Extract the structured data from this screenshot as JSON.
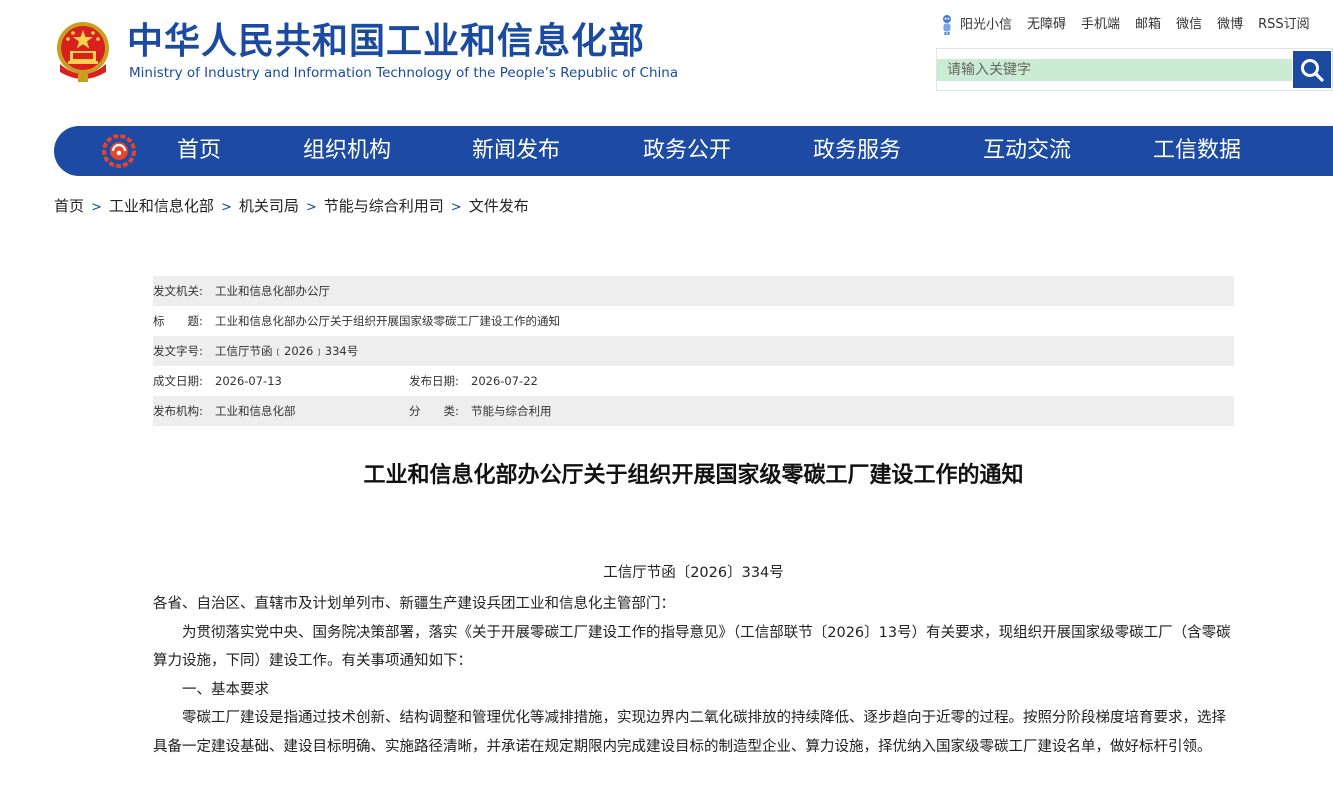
{
  "header": {
    "title_cn": "中华人民共和国工业和信息化部",
    "title_en": "Ministry of Industry and Information Technology of the People’s Republic of China",
    "top_links": [
      "阳光小信",
      "无障碍",
      "手机端",
      "邮箱",
      "微信",
      "微博",
      "RSS订阅"
    ],
    "search_placeholder": "请输入关键字"
  },
  "nav": {
    "items": [
      "首页",
      "组织机构",
      "新闻发布",
      "政务公开",
      "政务服务",
      "互动交流",
      "工信数据"
    ]
  },
  "breadcrumb": [
    "首页",
    "工业和信息化部",
    "机关司局",
    "节能与综合利用司",
    "文件发布"
  ],
  "meta": {
    "issuer_label": "发文机关:",
    "issuer": "工业和信息化部办公厅",
    "title_label": "标　　题:",
    "title": "工业和信息化部办公厅关于组织开展国家级零碳工厂建设工作的通知",
    "doc_no_label": "发文字号:",
    "doc_no": "工信厅节函﹝2026﹞334号",
    "written_label": "成文日期:",
    "written": "2026-07-13",
    "published_label": "发布日期:",
    "published": "2026-07-22",
    "org_label": "发布机构:",
    "org": "工业和信息化部",
    "category_label": "分　　类:",
    "category": "节能与综合利用"
  },
  "document": {
    "title": "工业和信息化部办公厅关于组织开展国家级零碳工厂建设工作的通知",
    "number": "工信厅节函〔2026〕334号",
    "addressee": "各省、自治区、直辖市及计划单列市、新疆生产建设兵团工业和信息化主管部门：",
    "para1": "为贯彻落实党中央、国务院决策部署，落实《关于开展零碳工厂建设工作的指导意见》（工信部联节〔2026〕13号）有关要求，现组织开展国家级零碳工厂（含零碳算力设施，下同）建设工作。有关事项通知如下：",
    "section1": "一、基本要求",
    "para2": "零碳工厂建设是指通过技术创新、结构调整和管理优化等减排措施，实现边界内二氧化碳排放的持续降低、逐步趋向于近零的过程。按照分阶段梯度培育要求，选择具备一定建设基础、建设目标明确、实施路径清晰，并承诺在规定期限内完成建设目标的制造型企业、算力设施，择优纳入国家级零碳工厂建设名单，做好标杆引领。"
  },
  "colors": {
    "brand_blue": "#1d4ba3",
    "search_bg": "#c9ecd2",
    "meta_row_shade": "#eeeeee"
  }
}
